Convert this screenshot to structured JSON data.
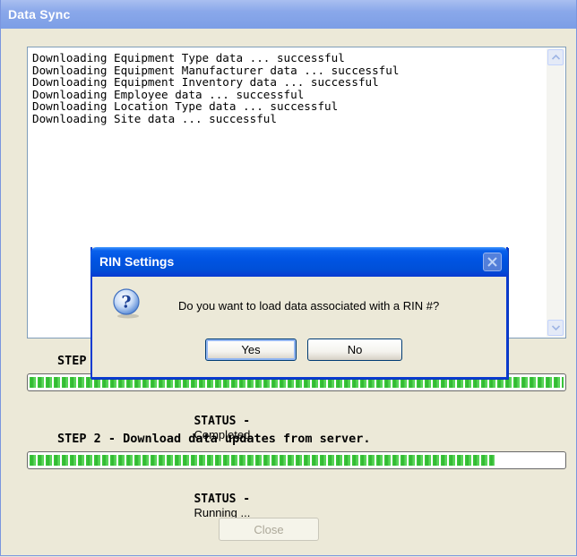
{
  "window": {
    "title": "Data Sync"
  },
  "log": {
    "lines": [
      "Downloading Equipment Type data ... successful",
      "Downloading Equipment Manufacturer data ... successful",
      "Downloading Equipment Inventory data ... successful",
      "Downloading Employee data ... successful",
      "Downloading Location Type data ... successful",
      "Downloading Site data ... successful"
    ]
  },
  "step1": {
    "label": "STEP",
    "progress": 100,
    "status_key": "STATUS -",
    "status_value": "Completed"
  },
  "step2": {
    "label": "STEP 2 - Download data updates from server.",
    "progress": 87,
    "status_key": "STATUS -",
    "status_value": "Running ..."
  },
  "close_button": {
    "label": "Close",
    "enabled": false
  },
  "dialog": {
    "title": "RIN Settings",
    "icon": "question-icon",
    "message": "Do you want to load data associated with a RIN #?",
    "yes_label": "Yes",
    "no_label": "No"
  },
  "colors": {
    "window_title_bar": "#8aa8ea",
    "dialog_title_bar": "#0054e3",
    "progress_green": "#3ccb3c",
    "window_background": "#ece9d8"
  }
}
